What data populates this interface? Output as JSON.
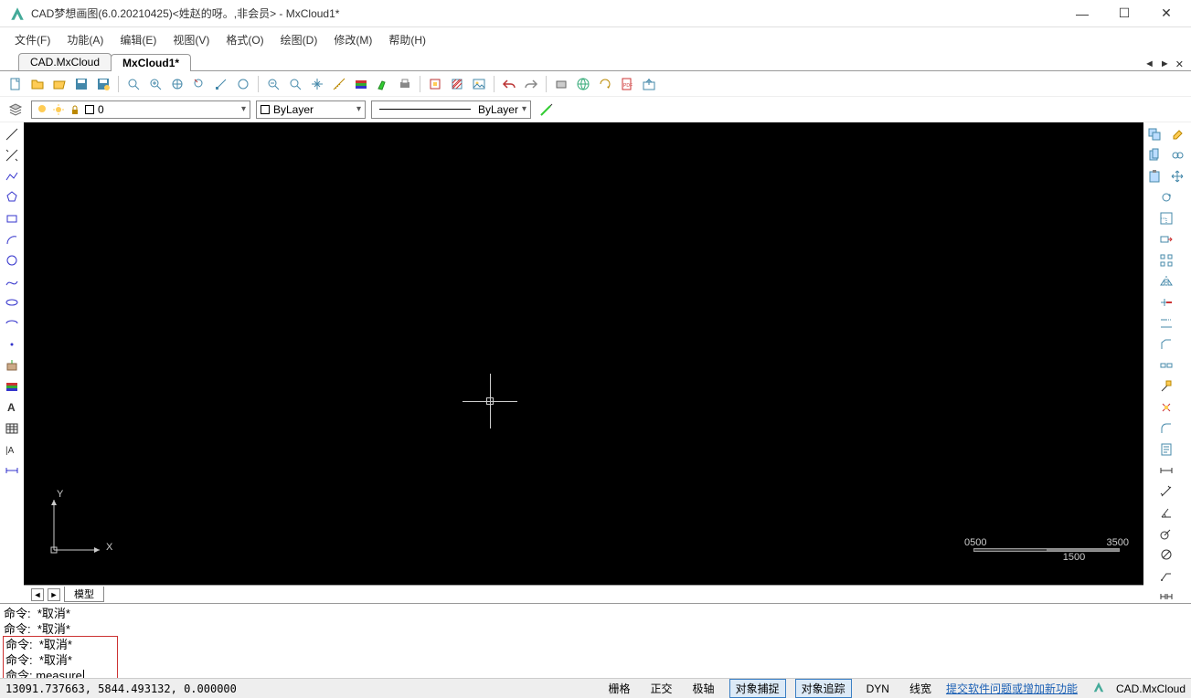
{
  "titlebar": {
    "app_title": "CAD梦想画图(6.0.20210425)<姓赵的呀。,非会员> - MxCloud1*"
  },
  "menu": {
    "file": "文件(F)",
    "function": "功能(A)",
    "edit": "编辑(E)",
    "view": "视图(V)",
    "format": "格式(O)",
    "draw": "绘图(D)",
    "modify": "修改(M)",
    "help": "帮助(H)"
  },
  "tabs": {
    "tab0": "CAD.MxCloud",
    "tab1": "MxCloud1*"
  },
  "layerbar": {
    "layer_value": "0",
    "bylayer_color": "ByLayer",
    "bylayer_linetype": "ByLayer"
  },
  "scale": {
    "s0": "0",
    "s500": "500",
    "s1500": "1500",
    "s3500": "3500"
  },
  "ucs": {
    "y": "Y",
    "x": "X"
  },
  "canvas_tab": {
    "model": "模型"
  },
  "cmd": {
    "l1": "命令:  *取消*",
    "l2": "命令:  *取消*",
    "l3": "命令:  *取消*",
    "l4": "命令:  *取消*",
    "prompt": "命令: ",
    "input": "measure"
  },
  "status": {
    "coords": "13091.737663,  5844.493132,  0.000000",
    "grid": "栅格",
    "ortho": "正交",
    "polar": "极轴",
    "osnap": "对象捕捉",
    "otrack": "对象追踪",
    "dyn": "DYN",
    "lwt": "线宽",
    "feedback": "提交软件问题或增加新功能",
    "brand": "CAD.MxCloud"
  }
}
